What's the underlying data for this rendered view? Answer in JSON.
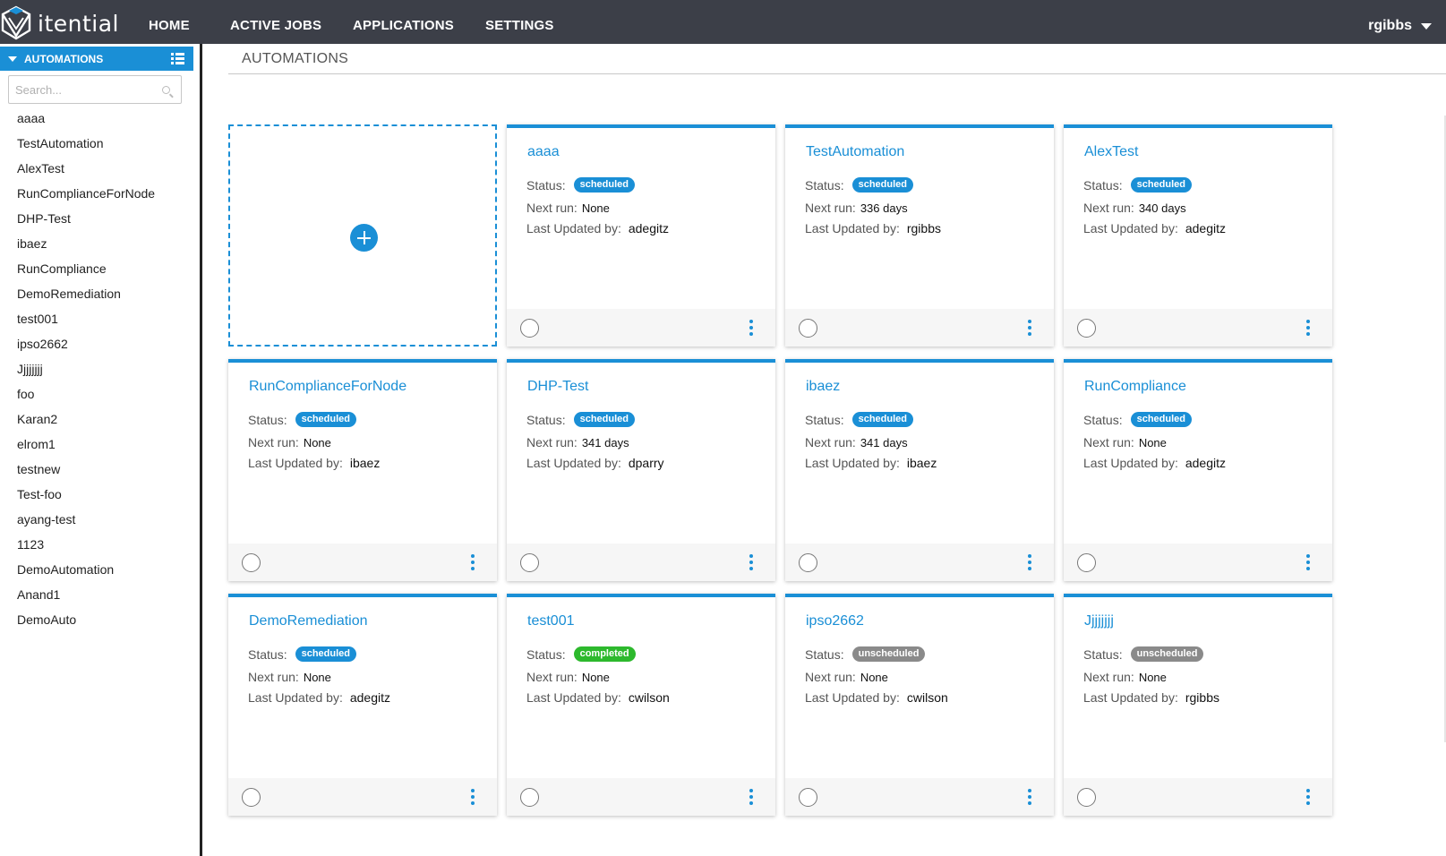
{
  "brand": {
    "name": "itential"
  },
  "nav": {
    "items": [
      "HOME",
      "ACTIVE JOBS",
      "APPLICATIONS",
      "SETTINGS"
    ],
    "user": "rgibbs"
  },
  "sidebar": {
    "header": "AUTOMATIONS",
    "search_placeholder": "Search...",
    "items": [
      "aaaa",
      "TestAutomation",
      "AlexTest",
      "RunComplianceForNode",
      "DHP-Test",
      "ibaez",
      "RunCompliance",
      "DemoRemediation",
      "test001",
      "ipso2662",
      "Jjjjjjjj",
      "foo",
      "Karan2",
      "elrom1",
      "testnew",
      "Test-foo",
      "ayang-test",
      "1123",
      "DemoAutomation",
      "Anand1",
      "DemoAuto"
    ]
  },
  "main": {
    "title": "AUTOMATIONS",
    "labels": {
      "status": "Status:",
      "next_run": "Next run:",
      "last_updated": "Last Updated by:"
    },
    "cards": [
      {
        "title": "aaaa",
        "status": "scheduled",
        "next_run": "None",
        "updated_by": "adegitz"
      },
      {
        "title": "TestAutomation",
        "status": "scheduled",
        "next_run": "336 days",
        "updated_by": "rgibbs"
      },
      {
        "title": "AlexTest",
        "status": "scheduled",
        "next_run": "340 days",
        "updated_by": "adegitz"
      },
      {
        "title": "RunComplianceForNode",
        "status": "scheduled",
        "next_run": "None",
        "updated_by": "ibaez"
      },
      {
        "title": "DHP-Test",
        "status": "scheduled",
        "next_run": "341 days",
        "updated_by": "dparry"
      },
      {
        "title": "ibaez",
        "status": "scheduled",
        "next_run": "341 days",
        "updated_by": "ibaez"
      },
      {
        "title": "RunCompliance",
        "status": "scheduled",
        "next_run": "None",
        "updated_by": "adegitz"
      },
      {
        "title": "DemoRemediation",
        "status": "scheduled",
        "next_run": "None",
        "updated_by": "adegitz"
      },
      {
        "title": "test001",
        "status": "completed",
        "next_run": "None",
        "updated_by": "cwilson"
      },
      {
        "title": "ipso2662",
        "status": "unscheduled",
        "next_run": "None",
        "updated_by": "cwilson"
      },
      {
        "title": "Jjjjjjjj",
        "status": "unscheduled",
        "next_run": "None",
        "updated_by": "rgibbs"
      }
    ]
  },
  "colors": {
    "accent": "#1a8fd6",
    "nav_bg": "#3c3f48",
    "completed": "#2db92d",
    "unscheduled": "#8a8a8a"
  },
  "icons": {
    "add": "plus-icon",
    "menu": "kebab-icon",
    "select": "radio-circle-icon",
    "search": "search-icon",
    "list": "list-icon"
  }
}
